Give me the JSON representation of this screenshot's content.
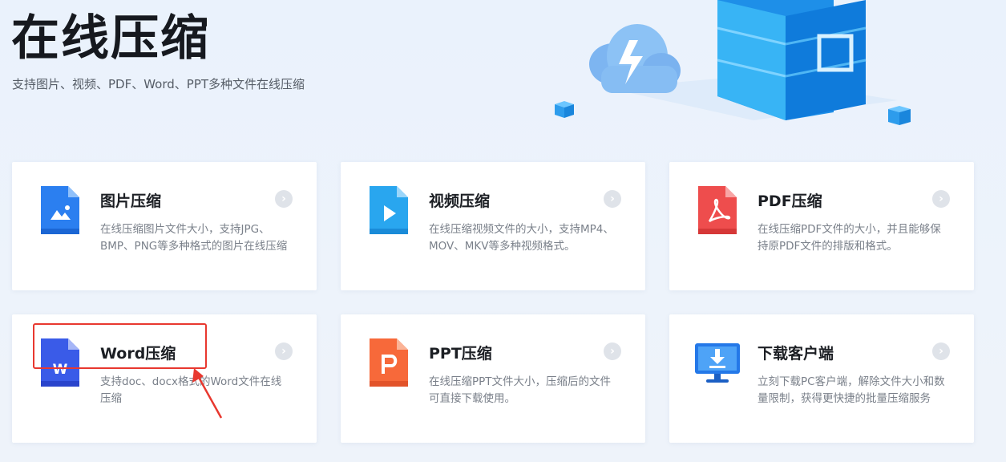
{
  "hero": {
    "title": "在线压缩",
    "subtitle": "支持图片、视频、PDF、Word、PPT多种文件在线压缩"
  },
  "cards": [
    {
      "title": "图片压缩",
      "desc": "在线压缩图片文件大小，支持JPG、BMP、PNG等多种格式的图片在线压缩",
      "icon": "image-file-icon",
      "arrow": "›"
    },
    {
      "title": "视频压缩",
      "desc": "在线压缩视频文件的大小，支持MP4、MOV、MKV等多种视频格式。",
      "icon": "video-file-icon",
      "arrow": "›"
    },
    {
      "title": "PDF压缩",
      "desc": "在线压缩PDF文件的大小，并且能够保持原PDF文件的排版和格式。",
      "icon": "pdf-file-icon",
      "arrow": "›"
    },
    {
      "title": "Word压缩",
      "desc": "支持doc、docx格式的Word文件在线压缩",
      "icon": "word-file-icon",
      "arrow": "›"
    },
    {
      "title": "PPT压缩",
      "desc": "在线压缩PPT文件大小，压缩后的文件可直接下载使用。",
      "icon": "ppt-file-icon",
      "arrow": "›"
    },
    {
      "title": "下载客户端",
      "desc": "立刻下载PC客户端，解除文件大小和数量限制，获得更快捷的批量压缩服务",
      "icon": "download-monitor-icon",
      "arrow": "›"
    }
  ],
  "icon_letters": {
    "word": "W"
  },
  "colors": {
    "image": "#2b7ff0",
    "video": "#29a6ef",
    "pdf": "#ee4d4d",
    "word": "#3a5be8",
    "ppt": "#f7693a",
    "client": "#2478e8",
    "highlight": "#e8382f"
  }
}
